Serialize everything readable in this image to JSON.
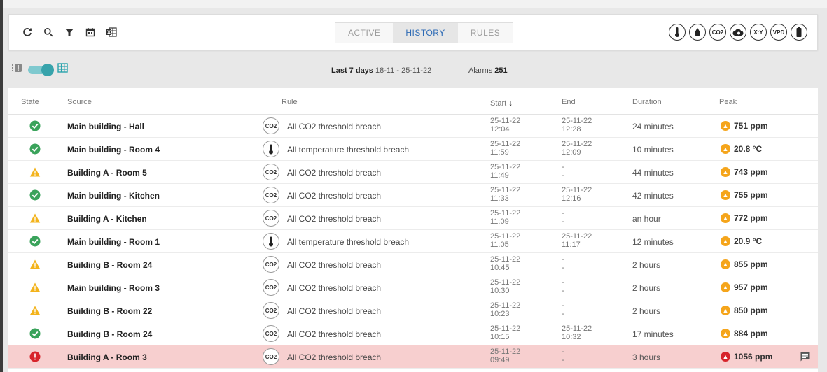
{
  "tabs": [
    {
      "label": "ACTIVE",
      "active": false
    },
    {
      "label": "HISTORY",
      "active": true
    },
    {
      "label": "RULES",
      "active": false
    }
  ],
  "toolbar_icons": [
    "refresh-icon",
    "search-icon",
    "filter-icon",
    "calendar-icon",
    "export-excel-icon"
  ],
  "sensor_filters": [
    {
      "name": "temperature-sensor-icon",
      "label": ""
    },
    {
      "name": "humidity-sensor-icon",
      "label": ""
    },
    {
      "name": "co2-sensor-icon",
      "label": "CO2"
    },
    {
      "name": "cloud-sensor-icon",
      "label": ""
    },
    {
      "name": "xy-sensor-icon",
      "label": "X:Y"
    },
    {
      "name": "vpd-sensor-icon",
      "label": "VPD"
    },
    {
      "name": "battery-sensor-icon",
      "label": ""
    }
  ],
  "subbar": {
    "range_label": "Last 7 days",
    "range_dates": "18-11 - 25-11-22",
    "alarms_label": "Alarms",
    "alarms_count": "251",
    "toggle_on": true
  },
  "columns": {
    "state": "State",
    "source": "Source",
    "rule": "Rule",
    "start": "Start",
    "end": "End",
    "duration": "Duration",
    "peak": "Peak"
  },
  "colors": {
    "ok": "#3aa35b",
    "warning": "#f3b31b",
    "alarm": "#d7242b",
    "accent": "#2e6bb5",
    "toggle": "#37a3ab"
  },
  "rows": [
    {
      "state": "ok",
      "source": "Main building - Hall",
      "rule_icon": "CO2",
      "rule": "All CO2 threshold breach",
      "start_date": "25-11-22",
      "start_time": "12:04",
      "end_date": "25-11-22",
      "end_time": "12:28",
      "duration": "24 minutes",
      "peak": "751 ppm",
      "peak_level": "warning"
    },
    {
      "state": "ok",
      "source": "Main building - Room 4",
      "rule_icon": "temp",
      "rule": "All temperature threshold breach",
      "start_date": "25-11-22",
      "start_time": "11:59",
      "end_date": "25-11-22",
      "end_time": "12:09",
      "duration": "10 minutes",
      "peak": "20.8 °C",
      "peak_level": "warning"
    },
    {
      "state": "warning",
      "source": "Building A - Room 5",
      "rule_icon": "CO2",
      "rule": "All CO2 threshold breach",
      "start_date": "25-11-22",
      "start_time": "11:49",
      "end_date": "-",
      "end_time": "-",
      "duration": "44 minutes",
      "peak": "743 ppm",
      "peak_level": "warning"
    },
    {
      "state": "ok",
      "source": "Main building - Kitchen",
      "rule_icon": "CO2",
      "rule": "All CO2 threshold breach",
      "start_date": "25-11-22",
      "start_time": "11:33",
      "end_date": "25-11-22",
      "end_time": "12:16",
      "duration": "42 minutes",
      "peak": "755 ppm",
      "peak_level": "warning"
    },
    {
      "state": "warning",
      "source": "Building A - Kitchen",
      "rule_icon": "CO2",
      "rule": "All CO2 threshold breach",
      "start_date": "25-11-22",
      "start_time": "11:09",
      "end_date": "-",
      "end_time": "-",
      "duration": "an hour",
      "peak": "772 ppm",
      "peak_level": "warning"
    },
    {
      "state": "ok",
      "source": "Main building - Room 1",
      "rule_icon": "temp",
      "rule": "All temperature threshold breach",
      "start_date": "25-11-22",
      "start_time": "11:05",
      "end_date": "25-11-22",
      "end_time": "11:17",
      "duration": "12 minutes",
      "peak": "20.9 °C",
      "peak_level": "warning"
    },
    {
      "state": "warning",
      "source": "Building B - Room 24",
      "rule_icon": "CO2",
      "rule": "All CO2 threshold breach",
      "start_date": "25-11-22",
      "start_time": "10:45",
      "end_date": "-",
      "end_time": "-",
      "duration": "2 hours",
      "peak": "855 ppm",
      "peak_level": "warning"
    },
    {
      "state": "warning",
      "source": "Main building - Room 3",
      "rule_icon": "CO2",
      "rule": "All CO2 threshold breach",
      "start_date": "25-11-22",
      "start_time": "10:30",
      "end_date": "-",
      "end_time": "-",
      "duration": "2 hours",
      "peak": "957 ppm",
      "peak_level": "warning"
    },
    {
      "state": "warning",
      "source": "Building B - Room 22",
      "rule_icon": "CO2",
      "rule": "All CO2 threshold breach",
      "start_date": "25-11-22",
      "start_time": "10:23",
      "end_date": "-",
      "end_time": "-",
      "duration": "2 hours",
      "peak": "850 ppm",
      "peak_level": "warning"
    },
    {
      "state": "ok",
      "source": "Building B - Room 24",
      "rule_icon": "CO2",
      "rule": "All CO2 threshold breach",
      "start_date": "25-11-22",
      "start_time": "10:15",
      "end_date": "25-11-22",
      "end_time": "10:32",
      "duration": "17 minutes",
      "peak": "884 ppm",
      "peak_level": "warning"
    },
    {
      "state": "alarm",
      "source": "Building A - Room 3",
      "rule_icon": "CO2",
      "rule": "All CO2 threshold breach",
      "start_date": "25-11-22",
      "start_time": "09:49",
      "end_date": "-",
      "end_time": "-",
      "duration": "3 hours",
      "peak": "1056 ppm",
      "peak_level": "alarm",
      "has_comment": true
    }
  ]
}
